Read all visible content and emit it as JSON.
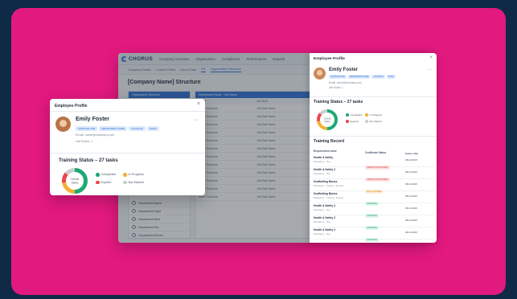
{
  "app": {
    "logo": "CHORUS",
    "nav": [
      "Company Overview",
      "Organization",
      "Compliance",
      "Performance",
      "Reports"
    ],
    "subnav": [
      "Company Details",
      "Custom Fields",
      "Import Data",
      "IST",
      "Organization Structure"
    ],
    "page_title": "[Company Name] Structure",
    "left_panel_header": "Organization Structure",
    "left_rows": [
      "Department Name",
      "Department Eight",
      "Department Nine",
      "Department Ten",
      "Department Eleven"
    ],
    "search_placeholder": "Department Name · Job Name",
    "table_headers": [
      "Name",
      "Job Role"
    ],
    "table_rows": [
      [
        "Name Surname",
        "Job Role Name"
      ],
      [
        "Name Surname",
        "Job Role Name"
      ],
      [
        "Name Surname",
        "Job Role Name"
      ],
      [
        "Name Surname",
        "Job Role Name"
      ],
      [
        "Name Surname",
        "Job Role Name"
      ],
      [
        "Name Surname",
        "Job Role Name"
      ],
      [
        "Name Surname",
        "Job Role Name"
      ],
      [
        "Name Surname",
        "Job Role Name"
      ],
      [
        "Name Surname",
        "Job Role Name"
      ],
      [
        "Name Surname",
        "Job Role Name"
      ],
      [
        "Name Surname",
        "Job Role Name"
      ],
      [
        "Name Surname",
        "Job Role Name"
      ]
    ]
  },
  "drawer": {
    "title": "Employee Profile",
    "close": "×",
    "name": "Emily Foster",
    "more": "···",
    "tags": [
      "JOB ROLE ONE",
      "DEPARTMENT NAME",
      "LOCATION",
      "STAFF"
    ],
    "email": "Email: name@company.com",
    "job_roles": "Job Roles: 1",
    "training_title": "Training Status – 27 tasks",
    "donut_center": "Overall Status",
    "legend": [
      "Completed",
      "In Progress",
      "Expired",
      "Not Started"
    ],
    "record_title": "Training Record",
    "record_headers": [
      "Requirement name",
      "Certificate Status",
      "Expiry date"
    ],
    "records": [
      {
        "name": "Health & Safety",
        "sub": "Mandatory · Due",
        "status": "CERTIFICATE EXPIRED",
        "kind": "red",
        "date": "08/12/2025"
      },
      {
        "name": "Health & Safety 2",
        "sub": "Mandatory · Due",
        "status": "CERTIFICATE EXPIRED",
        "kind": "red",
        "date": "08/12/2025"
      },
      {
        "name": "Scaffolding Basics",
        "sub": "Mandatory · Training · Renew",
        "status": "DUE TO EXPIRE",
        "kind": "orange",
        "date": "08/12/2025"
      },
      {
        "name": "Scaffolding Basics",
        "sub": "Mandatory · Training · Renew",
        "status": "COMPLETE",
        "kind": "green",
        "date": "08/12/2025"
      },
      {
        "name": "Health & Safety 3",
        "sub": "Mandatory · Due",
        "status": "COMPLETE",
        "kind": "green",
        "date": "08/12/2025"
      },
      {
        "name": "Health & Safety 3",
        "sub": "Mandatory · Due",
        "status": "COMPLETE",
        "kind": "green",
        "date": "08/12/2025"
      },
      {
        "name": "Health & Safety 3",
        "sub": "Mandatory · Due",
        "status": "COMPLETE",
        "kind": "green",
        "date": "08/12/2025"
      }
    ]
  },
  "card": {
    "title": "Employee Profile",
    "close": "×",
    "name": "Emily Foster",
    "more": "···",
    "tags": [
      "JOB ROLE ONE",
      "DEPARTMENT NAME",
      "LOCATION",
      "STAFF"
    ],
    "email": "Email: name@company.com",
    "job_roles": "Job Roles: 1",
    "training_title": "Training Status – 27 tasks",
    "donut_center": "Overall Status",
    "legend": [
      "Completed",
      "In Progress",
      "Expired",
      "Not Started"
    ]
  },
  "colors": {
    "background": "#0e2a47",
    "pink": "#e2197f",
    "completed": "#1fa874",
    "in_progress": "#f2b233",
    "expired": "#e8474d",
    "not_started": "#c9ced6",
    "accent": "#2d6fd6"
  },
  "donut": {
    "completed": 0.5,
    "in_progress": 0.22,
    "expired": 0.14,
    "not_started": 0.14
  }
}
